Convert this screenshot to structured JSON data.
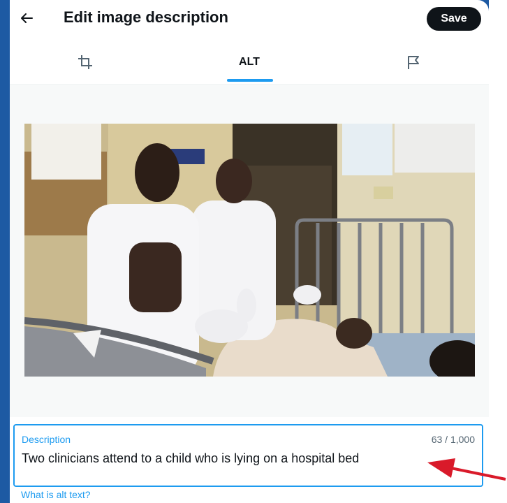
{
  "dialog": {
    "title": "Edit image description",
    "save_label": "Save"
  },
  "tabs": [
    {
      "id": "crop",
      "icon": "crop-icon",
      "label": ""
    },
    {
      "id": "alt",
      "label": "ALT",
      "active": true
    },
    {
      "id": "flag",
      "icon": "flag-icon",
      "label": ""
    }
  ],
  "description": {
    "label": "Description",
    "value": "Two clinicians attend to a child who is lying on a hospital bed",
    "count": "63 / 1,000"
  },
  "help_link": "What is alt text?",
  "colors": {
    "accent": "#1d9bf0",
    "text": "#0f1419",
    "muted": "#536471",
    "annotation_arrow": "#d91a2a"
  }
}
